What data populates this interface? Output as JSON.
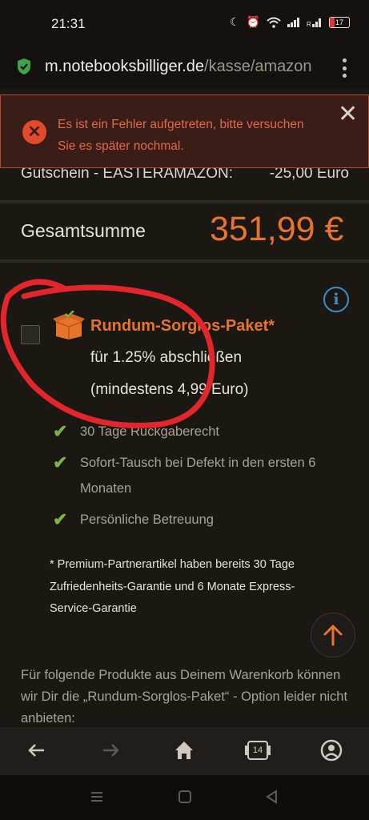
{
  "status_bar": {
    "time": "21:31",
    "battery": "17"
  },
  "url_bar": {
    "domain": "m.notebooksbilliger.de",
    "path": "/kasse/amazon"
  },
  "error": {
    "message": "Es ist ein Fehler aufgetreten, bitte versuchen Sie es später nochmal."
  },
  "voucher_row": {
    "label": "Gutschein - EASTERAMAZON:",
    "value": "-25,00 Euro"
  },
  "total": {
    "label": "Gesamtsumme",
    "value": "351,99 €"
  },
  "package": {
    "title": "Rundum-Sorglos-Paket*",
    "line1": "für 1.25% abschließen",
    "line2": "(mindestens 4,99 Euro)",
    "checked": false
  },
  "features": [
    {
      "text": "30 Tage Rückgaberecht"
    },
    {
      "text": "Sofort-Tausch bei Defekt in den ersten 6 Monaten"
    },
    {
      "text": "Persönliche Betreuung"
    }
  ],
  "note": "* Premium-Partnerartikel haben bereits 30 Tage Zufriedenheits-Garantie und 6 Monate Express-Service-Garantie",
  "bottom_text": "Für folgende Produkte aus Deinem Warenkorb können wir Dir die „Rundum-Sorglos-Paket“ - Option leider nicht anbieten:",
  "browser_nav": {
    "tabs_count": "14"
  },
  "colors": {
    "accent": "#e8742c",
    "error": "#e14a2c",
    "check": "#7cb342",
    "info": "#3b8fc8"
  }
}
